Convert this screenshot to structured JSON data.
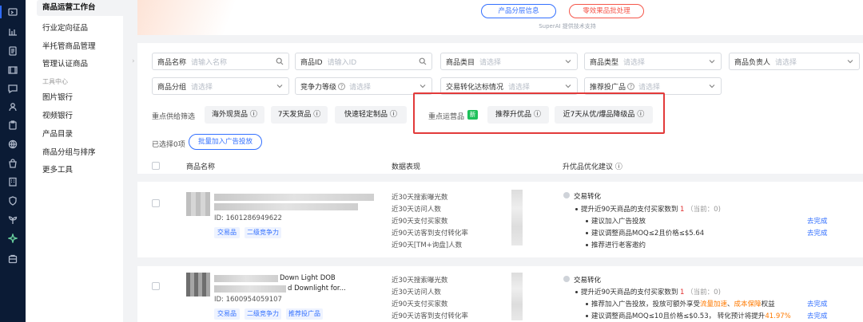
{
  "rail_icons": [
    "deliver-icon",
    "chart-icon",
    "orders-icon",
    "video-icon",
    "message-icon",
    "users-icon",
    "clipboard-icon",
    "globe-icon",
    "bag-icon",
    "building-icon",
    "shield-icon",
    "plant-icon",
    "sparkle-icon",
    "card-icon"
  ],
  "sidebar": {
    "items": [
      "商品运营工作台",
      "行业定向征品",
      "半托管商品管理",
      "管理认证商品"
    ],
    "section_label": "工具中心",
    "tools": [
      "图片银行",
      "视频银行",
      "产品目录",
      "商品分组与排序",
      "更多工具"
    ]
  },
  "banner": {
    "button_layer": "产品分层信息",
    "button_inefficient": "零效果品批处理",
    "powered_by": "SuperAI 提供技术支持"
  },
  "filters": {
    "row1": [
      {
        "label": "商品名称",
        "placeholder": "请输入名称",
        "icon": "search-icon"
      },
      {
        "label": "商品ID",
        "placeholder": "请输入ID",
        "icon": "search-icon"
      },
      {
        "label": "商品类目",
        "placeholder": "请选择",
        "icon": "chevron-down-icon"
      },
      {
        "label": "商品类型",
        "placeholder": "请选择",
        "icon": "chevron-down-icon"
      },
      {
        "label": "商品负责人",
        "placeholder": "请选择",
        "icon": "chevron-down-icon"
      }
    ],
    "row2": [
      {
        "label": "商品分组",
        "placeholder": "请选择",
        "icon": "chevron-down-icon"
      },
      {
        "label": "竞争力等级",
        "placeholder": "请选择",
        "icon": "chevron-down-icon",
        "help": "?"
      },
      {
        "label": "交易转化达标情况",
        "placeholder": "请选择",
        "icon": "chevron-down-icon"
      },
      {
        "label": "推荐投广品",
        "placeholder": "请选择",
        "icon": "chevron-down-icon",
        "help": "?"
      }
    ]
  },
  "quick_filter": {
    "caption": "重点供给筛选",
    "tags": [
      "海外现货品",
      "7天发货品",
      "快速轻定制品"
    ],
    "ops_caption": "重点运营品",
    "new_badge": "新",
    "ops_tags": [
      "推荐升优品",
      "近7天从优/爆品降级品"
    ]
  },
  "selection": {
    "selected_text": "已选择0项",
    "batch_button": "批量加入广告投放"
  },
  "table_headers": {
    "name": "商品名称",
    "data": "数据表现",
    "suggest": "升优品优化建议"
  },
  "rows": [
    {
      "id_text": "ID: 1601286949622",
      "chips": [
        "交易品",
        "二级竞争力"
      ],
      "metrics": [
        "近30天搜索曝光数",
        "近30天访问人数",
        "近90天支付买家数",
        "近90天访客到支付转化率",
        "近90天[TM+询盘]人数"
      ],
      "suggest_title": "交易转化",
      "suggest_line": "提升近90天商品的支付买家数到",
      "suggest_target": "1",
      "suggest_current": "（当前：0)",
      "bullets": [
        "建议加入广告投放",
        "建议调整商品MOQ≤2且价格≤$5.64",
        "推荐进行老客邀约"
      ],
      "links": [
        "去完成",
        "去完成"
      ]
    },
    {
      "title_fragment_1": "Down Light DOB",
      "title_fragment_2": "d Downlight for...",
      "id_text": "ID: 1600954059107",
      "chips": [
        "交易品",
        "二级竞争力",
        "推荐投广品"
      ],
      "metrics": [
        "近30天搜索曝光数",
        "近30天访问人数",
        "近90天支付买家数",
        "近90天访客到支付转化率"
      ],
      "suggest_title": "交易转化",
      "suggest_line": "提升近90天商品的支付买家数到",
      "suggest_target": "1",
      "suggest_current": "（当前：0)",
      "bullet1_pre": "推荐加入广告投放，投放可额外享受",
      "bullet1_hl1": "流量加速",
      "bullet1_sep": "、",
      "bullet1_hl2": "成本保障",
      "bullet1_post": "权益",
      "bullet2_pre": "建议调整商品MOQ≤10且价格≤$0.53，  转化预计将提升",
      "bullet2_pct": "41.97%",
      "links": [
        "去完成",
        "去完成"
      ]
    }
  ],
  "colors": {
    "accent": "#3370ff",
    "danger": "#e23a3a",
    "new_badge": "#1ec15a",
    "rail": "#0b1b35"
  }
}
